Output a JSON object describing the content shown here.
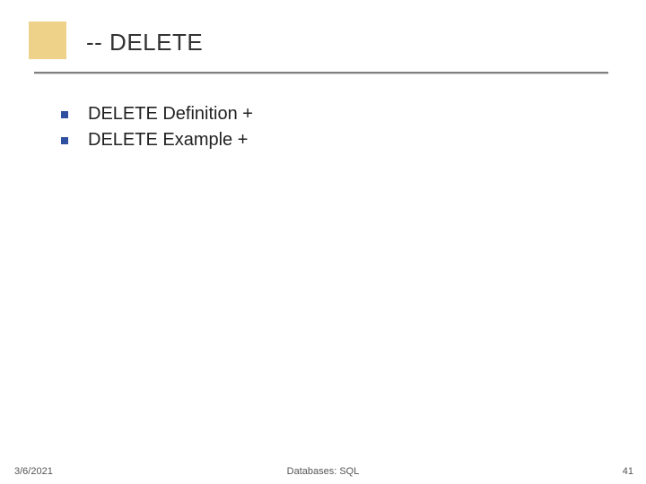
{
  "title": "-- DELETE",
  "bullets": [
    {
      "text": "DELETE Definition +"
    },
    {
      "text": "DELETE Example +"
    }
  ],
  "footer": {
    "date": "3/6/2021",
    "center": "Databases: SQL",
    "page": "41"
  }
}
